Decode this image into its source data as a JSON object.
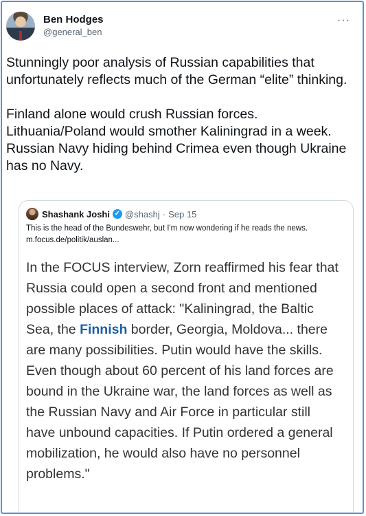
{
  "tweet": {
    "author": {
      "display_name": "Ben Hodges",
      "handle": "@general_ben",
      "avatar_icon": "avatar-photo"
    },
    "more_icon": "···",
    "paragraphs": [
      "Stunningly poor analysis of Russian capabilities that unfortunately reflects much of the German “elite” thinking.",
      "Finland alone would crush Russian forces. Lithuania/Poland would smother Kaliningrad in a week. Russian Navy hiding behind Crimea even though Ukraine has no Navy."
    ]
  },
  "quote": {
    "display_name": "Shashank Joshi",
    "verified_icon": "✓",
    "handle": "@shashj",
    "separator": "·",
    "date": "Sep 15",
    "text_line1": "This is the head of the Bundeswehr, but I'm now wondering if he reads the news.",
    "text_line2": "m.focus.de/politik/auslan...",
    "image_text_before": "In the FOCUS interview, Zorn reaffirmed his fear that Russia could open a second front and mentioned possible places of attack: \"Kaliningrad, the Baltic Sea, the ",
    "image_text_highlight": "Finnish",
    "image_text_after": " border, Georgia, Moldova... there are many possibilities. Putin would have the skills. Even though about 60 percent of his land forces are bound in the Ukraine war, the land forces as well as the Russian Navy and Air Force in particular still have unbound capacities. If Putin ordered a general mobilization, he would also have no personnel problems.\""
  },
  "colors": {
    "frame_border": "#5b8fd6",
    "link_highlight": "#1a5fa3",
    "verified": "#1d9bf0",
    "secondary_text": "#536471"
  }
}
